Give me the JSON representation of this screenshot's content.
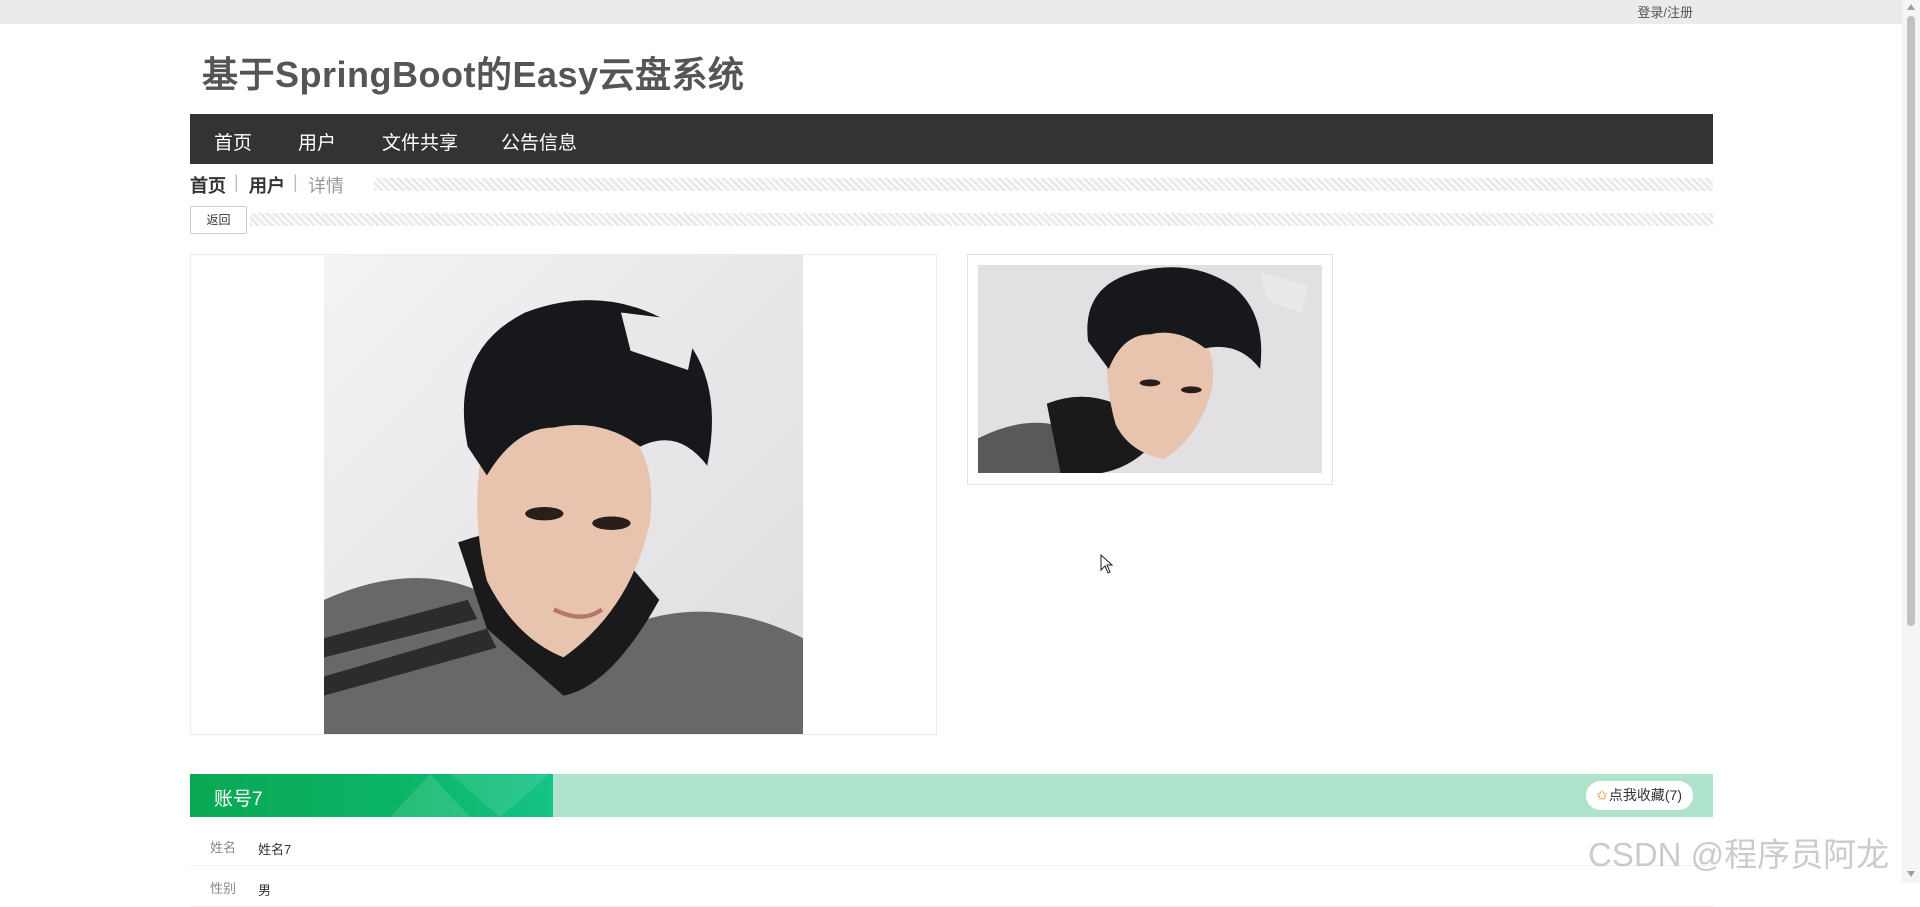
{
  "topbar": {
    "login_register": "登录/注册"
  },
  "site": {
    "title": "基于SpringBoot的Easy云盘系统"
  },
  "nav": {
    "items": [
      "首页",
      "用户",
      "文件共享",
      "公告信息"
    ]
  },
  "breadcrumb": {
    "home": "首页",
    "section": "用户",
    "current": "详情",
    "separator": "|"
  },
  "actions": {
    "back": "返回"
  },
  "detail": {
    "account": "账号7",
    "favorite": {
      "label": "点我收藏",
      "count": "(7)"
    },
    "fields": [
      {
        "label": "姓名",
        "value": "姓名7"
      },
      {
        "label": "性别",
        "value": "男"
      }
    ]
  },
  "watermark": "CSDN @程序员阿龙",
  "colors": {
    "nav_bg": "#333333",
    "banner_green": "#0aa854",
    "banner_light": "#b0e3cb",
    "favorite_star": "#e67e22"
  }
}
